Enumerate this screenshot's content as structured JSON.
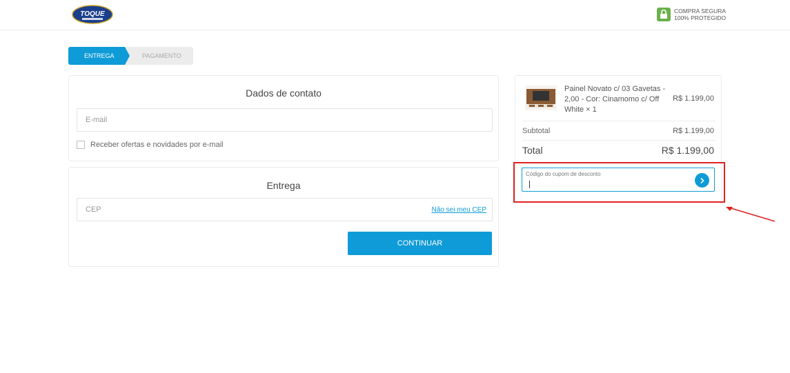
{
  "header": {
    "logo_text": "TOQUE",
    "secure_line1": "COMPRA SEGURA",
    "secure_line2": "100% PROTEGIDO"
  },
  "steps": [
    {
      "label": "ENTREGA",
      "active": true
    },
    {
      "label": "PAGAMENTO",
      "active": false
    }
  ],
  "contact": {
    "title": "Dados de contato",
    "email_placeholder": "E-mail",
    "newsletter_label": "Receber ofertas e novidades por e-mail"
  },
  "delivery": {
    "title": "Entrega",
    "cep_placeholder": "CEP",
    "cep_link": "Não sei meu CEP",
    "continue_label": "CONTINUAR"
  },
  "summary": {
    "product_name": "Painel Novato c/ 03 Gavetas - 2,00 - Cor: Cinamomo c/ Off White × 1",
    "product_price": "R$ 1.199,00",
    "subtotal_label": "Subtotal",
    "subtotal_value": "R$ 1.199,00",
    "total_label": "Total",
    "total_value": "R$ 1.199,00"
  },
  "coupon": {
    "label": "Código do cupom de desconto",
    "value": ""
  },
  "colors": {
    "accent": "#0f9bd7",
    "annotation": "#e02020",
    "secure_green": "#6ab04c"
  }
}
